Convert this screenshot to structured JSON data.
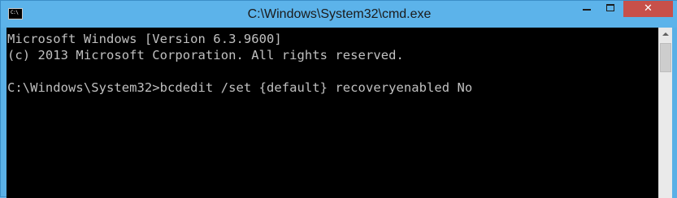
{
  "window": {
    "title": "C:\\Windows\\System32\\cmd.exe",
    "icon": "cmd-icon",
    "icon_glyph": "C:\\",
    "controls": {
      "minimize_icon": "minimize-icon",
      "maximize_icon": "maximize-icon",
      "close_icon": "close-icon",
      "close_glyph": "✕"
    },
    "colors": {
      "titlebar": "#5cb3ea",
      "close_button": "#c7504a",
      "console_background": "#000000",
      "console_text": "#c0c0c0"
    }
  },
  "console": {
    "lines": [
      "Microsoft Windows [Version 6.3.9600]",
      "(c) 2013 Microsoft Corporation. All rights reserved.",
      "C:\\Windows\\System32>bcdedit /set {default} recoveryenabled No"
    ]
  },
  "scrollbar": {
    "up_arrow_icon": "scroll-up-icon"
  }
}
